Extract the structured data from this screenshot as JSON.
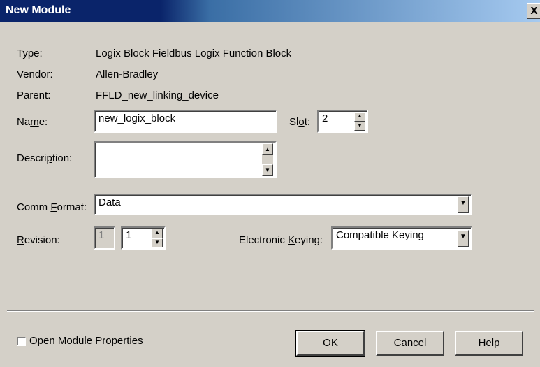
{
  "window": {
    "title": "New Module",
    "close_glyph": "X"
  },
  "info": [
    {
      "label": "Type:",
      "value": "Logix Block Fieldbus Logix Function Block"
    },
    {
      "label": "Vendor:",
      "value": "Allen-Bradley"
    },
    {
      "label": "Parent:",
      "value": "FFLD_new_linking_device"
    }
  ],
  "name": {
    "label_pre": "Na",
    "label_ul": "m",
    "label_post": "e:",
    "value": "new_logix_block"
  },
  "slot": {
    "label_pre": "Sl",
    "label_ul": "o",
    "label_post": "t:",
    "value": "2"
  },
  "description": {
    "label_pre": "Descri",
    "label_ul": "p",
    "label_post": "tion:",
    "value": ""
  },
  "comm_format": {
    "label_pre": "Comm ",
    "label_ul": "F",
    "label_post": "ormat:",
    "value": "Data"
  },
  "revision": {
    "label_pre": "",
    "label_ul": "R",
    "label_post": "evision:",
    "major": "1",
    "minor": "1"
  },
  "keying": {
    "label_pre": "Electronic ",
    "label_ul": "K",
    "label_post": "eying:",
    "value": "Compatible Keying"
  },
  "open_props": {
    "label_pre": "Open Modu",
    "label_ul": "l",
    "label_post": "e Properties",
    "checked": false
  },
  "buttons": {
    "ok": "OK",
    "cancel": "Cancel",
    "help": "Help"
  }
}
